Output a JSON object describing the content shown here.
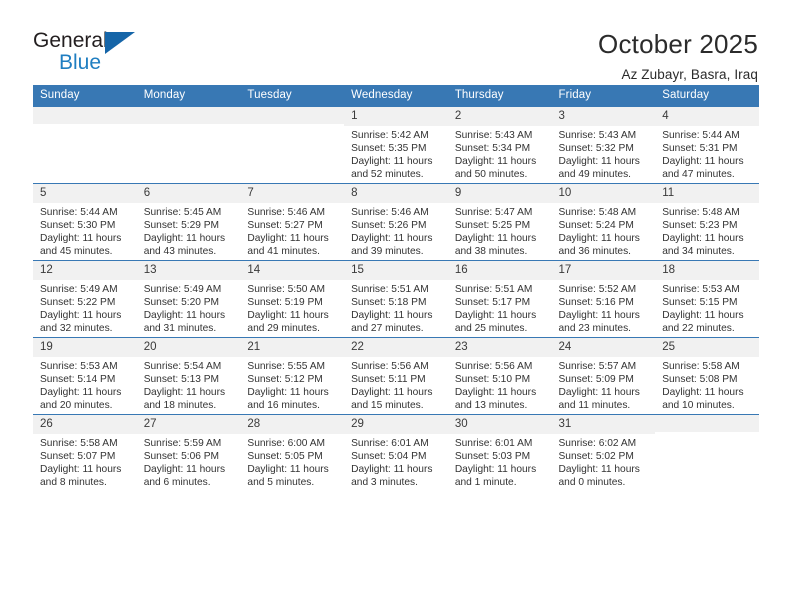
{
  "brand": {
    "name_part1": "General",
    "name_part2": "Blue",
    "logo_icon": "blue-triangle-icon"
  },
  "header": {
    "title": "October 2025",
    "subtitle": "Az Zubayr, Basra, Iraq"
  },
  "colors": {
    "header_blue": "#3878b4",
    "brand_blue": "#1f7ec1",
    "daynum_bg": "#f1f1f1",
    "text": "#333333"
  },
  "calendar": {
    "weekday_headers": [
      "Sunday",
      "Monday",
      "Tuesday",
      "Wednesday",
      "Thursday",
      "Friday",
      "Saturday"
    ],
    "weeks": [
      [
        {
          "day": "",
          "empty": true,
          "sunrise": "",
          "sunset": "",
          "daylight_line1": "",
          "daylight_line2": ""
        },
        {
          "day": "",
          "empty": true,
          "sunrise": "",
          "sunset": "",
          "daylight_line1": "",
          "daylight_line2": ""
        },
        {
          "day": "",
          "empty": true,
          "sunrise": "",
          "sunset": "",
          "daylight_line1": "",
          "daylight_line2": ""
        },
        {
          "day": "1",
          "empty": false,
          "sunrise": "Sunrise: 5:42 AM",
          "sunset": "Sunset: 5:35 PM",
          "daylight_line1": "Daylight: 11 hours",
          "daylight_line2": "and 52 minutes."
        },
        {
          "day": "2",
          "empty": false,
          "sunrise": "Sunrise: 5:43 AM",
          "sunset": "Sunset: 5:34 PM",
          "daylight_line1": "Daylight: 11 hours",
          "daylight_line2": "and 50 minutes."
        },
        {
          "day": "3",
          "empty": false,
          "sunrise": "Sunrise: 5:43 AM",
          "sunset": "Sunset: 5:32 PM",
          "daylight_line1": "Daylight: 11 hours",
          "daylight_line2": "and 49 minutes."
        },
        {
          "day": "4",
          "empty": false,
          "sunrise": "Sunrise: 5:44 AM",
          "sunset": "Sunset: 5:31 PM",
          "daylight_line1": "Daylight: 11 hours",
          "daylight_line2": "and 47 minutes."
        }
      ],
      [
        {
          "day": "5",
          "empty": false,
          "sunrise": "Sunrise: 5:44 AM",
          "sunset": "Sunset: 5:30 PM",
          "daylight_line1": "Daylight: 11 hours",
          "daylight_line2": "and 45 minutes."
        },
        {
          "day": "6",
          "empty": false,
          "sunrise": "Sunrise: 5:45 AM",
          "sunset": "Sunset: 5:29 PM",
          "daylight_line1": "Daylight: 11 hours",
          "daylight_line2": "and 43 minutes."
        },
        {
          "day": "7",
          "empty": false,
          "sunrise": "Sunrise: 5:46 AM",
          "sunset": "Sunset: 5:27 PM",
          "daylight_line1": "Daylight: 11 hours",
          "daylight_line2": "and 41 minutes."
        },
        {
          "day": "8",
          "empty": false,
          "sunrise": "Sunrise: 5:46 AM",
          "sunset": "Sunset: 5:26 PM",
          "daylight_line1": "Daylight: 11 hours",
          "daylight_line2": "and 39 minutes."
        },
        {
          "day": "9",
          "empty": false,
          "sunrise": "Sunrise: 5:47 AM",
          "sunset": "Sunset: 5:25 PM",
          "daylight_line1": "Daylight: 11 hours",
          "daylight_line2": "and 38 minutes."
        },
        {
          "day": "10",
          "empty": false,
          "sunrise": "Sunrise: 5:48 AM",
          "sunset": "Sunset: 5:24 PM",
          "daylight_line1": "Daylight: 11 hours",
          "daylight_line2": "and 36 minutes."
        },
        {
          "day": "11",
          "empty": false,
          "sunrise": "Sunrise: 5:48 AM",
          "sunset": "Sunset: 5:23 PM",
          "daylight_line1": "Daylight: 11 hours",
          "daylight_line2": "and 34 minutes."
        }
      ],
      [
        {
          "day": "12",
          "empty": false,
          "sunrise": "Sunrise: 5:49 AM",
          "sunset": "Sunset: 5:22 PM",
          "daylight_line1": "Daylight: 11 hours",
          "daylight_line2": "and 32 minutes."
        },
        {
          "day": "13",
          "empty": false,
          "sunrise": "Sunrise: 5:49 AM",
          "sunset": "Sunset: 5:20 PM",
          "daylight_line1": "Daylight: 11 hours",
          "daylight_line2": "and 31 minutes."
        },
        {
          "day": "14",
          "empty": false,
          "sunrise": "Sunrise: 5:50 AM",
          "sunset": "Sunset: 5:19 PM",
          "daylight_line1": "Daylight: 11 hours",
          "daylight_line2": "and 29 minutes."
        },
        {
          "day": "15",
          "empty": false,
          "sunrise": "Sunrise: 5:51 AM",
          "sunset": "Sunset: 5:18 PM",
          "daylight_line1": "Daylight: 11 hours",
          "daylight_line2": "and 27 minutes."
        },
        {
          "day": "16",
          "empty": false,
          "sunrise": "Sunrise: 5:51 AM",
          "sunset": "Sunset: 5:17 PM",
          "daylight_line1": "Daylight: 11 hours",
          "daylight_line2": "and 25 minutes."
        },
        {
          "day": "17",
          "empty": false,
          "sunrise": "Sunrise: 5:52 AM",
          "sunset": "Sunset: 5:16 PM",
          "daylight_line1": "Daylight: 11 hours",
          "daylight_line2": "and 23 minutes."
        },
        {
          "day": "18",
          "empty": false,
          "sunrise": "Sunrise: 5:53 AM",
          "sunset": "Sunset: 5:15 PM",
          "daylight_line1": "Daylight: 11 hours",
          "daylight_line2": "and 22 minutes."
        }
      ],
      [
        {
          "day": "19",
          "empty": false,
          "sunrise": "Sunrise: 5:53 AM",
          "sunset": "Sunset: 5:14 PM",
          "daylight_line1": "Daylight: 11 hours",
          "daylight_line2": "and 20 minutes."
        },
        {
          "day": "20",
          "empty": false,
          "sunrise": "Sunrise: 5:54 AM",
          "sunset": "Sunset: 5:13 PM",
          "daylight_line1": "Daylight: 11 hours",
          "daylight_line2": "and 18 minutes."
        },
        {
          "day": "21",
          "empty": false,
          "sunrise": "Sunrise: 5:55 AM",
          "sunset": "Sunset: 5:12 PM",
          "daylight_line1": "Daylight: 11 hours",
          "daylight_line2": "and 16 minutes."
        },
        {
          "day": "22",
          "empty": false,
          "sunrise": "Sunrise: 5:56 AM",
          "sunset": "Sunset: 5:11 PM",
          "daylight_line1": "Daylight: 11 hours",
          "daylight_line2": "and 15 minutes."
        },
        {
          "day": "23",
          "empty": false,
          "sunrise": "Sunrise: 5:56 AM",
          "sunset": "Sunset: 5:10 PM",
          "daylight_line1": "Daylight: 11 hours",
          "daylight_line2": "and 13 minutes."
        },
        {
          "day": "24",
          "empty": false,
          "sunrise": "Sunrise: 5:57 AM",
          "sunset": "Sunset: 5:09 PM",
          "daylight_line1": "Daylight: 11 hours",
          "daylight_line2": "and 11 minutes."
        },
        {
          "day": "25",
          "empty": false,
          "sunrise": "Sunrise: 5:58 AM",
          "sunset": "Sunset: 5:08 PM",
          "daylight_line1": "Daylight: 11 hours",
          "daylight_line2": "and 10 minutes."
        }
      ],
      [
        {
          "day": "26",
          "empty": false,
          "sunrise": "Sunrise: 5:58 AM",
          "sunset": "Sunset: 5:07 PM",
          "daylight_line1": "Daylight: 11 hours",
          "daylight_line2": "and 8 minutes."
        },
        {
          "day": "27",
          "empty": false,
          "sunrise": "Sunrise: 5:59 AM",
          "sunset": "Sunset: 5:06 PM",
          "daylight_line1": "Daylight: 11 hours",
          "daylight_line2": "and 6 minutes."
        },
        {
          "day": "28",
          "empty": false,
          "sunrise": "Sunrise: 6:00 AM",
          "sunset": "Sunset: 5:05 PM",
          "daylight_line1": "Daylight: 11 hours",
          "daylight_line2": "and 5 minutes."
        },
        {
          "day": "29",
          "empty": false,
          "sunrise": "Sunrise: 6:01 AM",
          "sunset": "Sunset: 5:04 PM",
          "daylight_line1": "Daylight: 11 hours",
          "daylight_line2": "and 3 minutes."
        },
        {
          "day": "30",
          "empty": false,
          "sunrise": "Sunrise: 6:01 AM",
          "sunset": "Sunset: 5:03 PM",
          "daylight_line1": "Daylight: 11 hours",
          "daylight_line2": "and 1 minute."
        },
        {
          "day": "31",
          "empty": false,
          "sunrise": "Sunrise: 6:02 AM",
          "sunset": "Sunset: 5:02 PM",
          "daylight_line1": "Daylight: 11 hours",
          "daylight_line2": "and 0 minutes."
        },
        {
          "day": "",
          "empty": true,
          "sunrise": "",
          "sunset": "",
          "daylight_line1": "",
          "daylight_line2": ""
        }
      ]
    ]
  }
}
